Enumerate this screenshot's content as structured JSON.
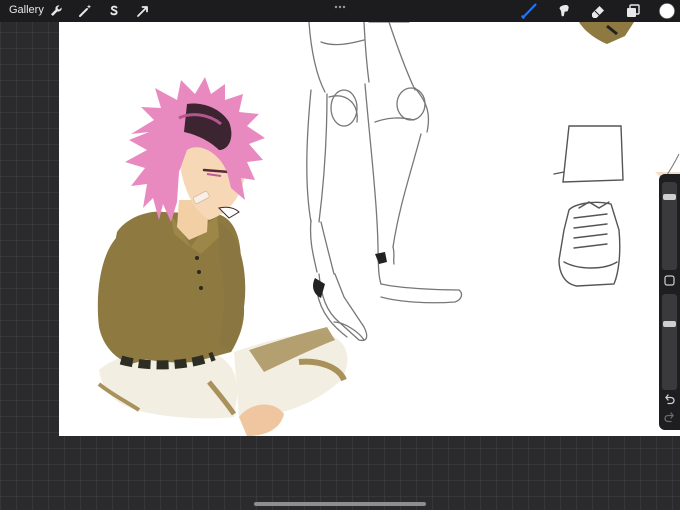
{
  "toolbar": {
    "gallery_label": "Gallery",
    "left_tools": [
      "wrench-icon",
      "magic-wand-icon",
      "selection-icon",
      "transform-arrow-icon"
    ],
    "right_tools": [
      "brush-icon",
      "smudge-icon",
      "eraser-icon",
      "layers-icon",
      "color-swatch-icon"
    ],
    "active_tool": "brush-icon",
    "active_color": "#1e78ff",
    "current_color": "#ffffff"
  },
  "sidebar": {
    "brush_size_level": 0.15,
    "opacity_level": 0.3,
    "buttons": [
      "modify-square-icon",
      "undo-icon",
      "redo-icon"
    ]
  }
}
